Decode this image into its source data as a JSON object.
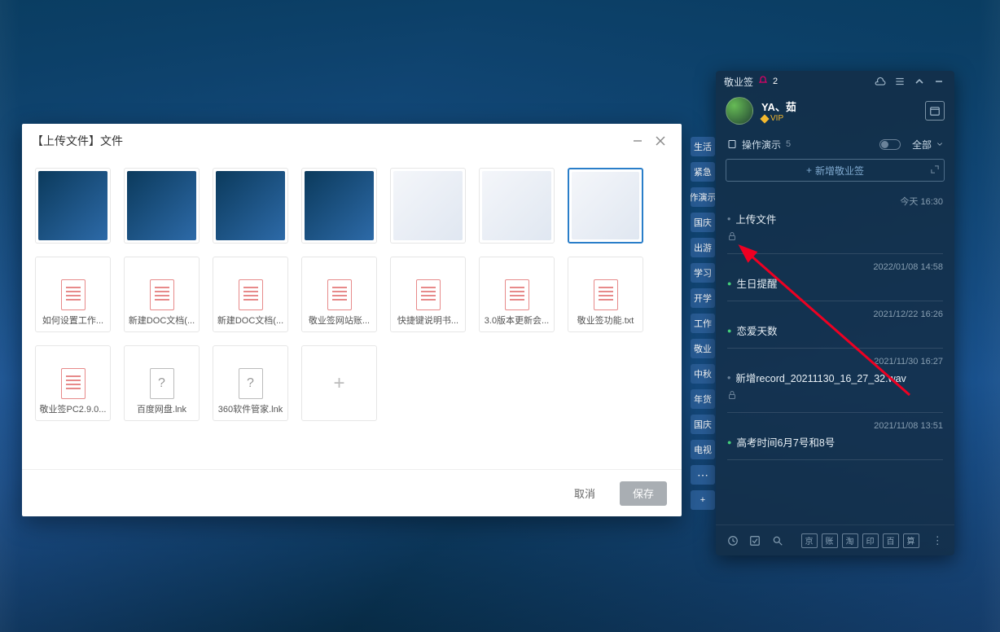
{
  "upload_dialog": {
    "title": "【上传文件】文件",
    "tiles": [
      {
        "type": "img",
        "variant": "dark",
        "name": "screenshot-1"
      },
      {
        "type": "img",
        "variant": "dark",
        "name": "screenshot-2"
      },
      {
        "type": "img",
        "variant": "dark",
        "name": "screenshot-3"
      },
      {
        "type": "img",
        "variant": "dark",
        "name": "screenshot-4"
      },
      {
        "type": "img",
        "variant": "light",
        "name": "screenshot-5"
      },
      {
        "type": "img",
        "variant": "light",
        "name": "screenshot-6"
      },
      {
        "type": "img",
        "variant": "light",
        "name": "screenshot-7",
        "selected": true
      },
      {
        "type": "doc",
        "label": "如何设置工作..."
      },
      {
        "type": "doc",
        "label": "新建DOC文档(..."
      },
      {
        "type": "doc",
        "label": "新建DOC文档(..."
      },
      {
        "type": "doc",
        "label": "敬业签网站账..."
      },
      {
        "type": "doc",
        "label": "快捷键说明书..."
      },
      {
        "type": "doc",
        "label": "3.0版本更新会..."
      },
      {
        "type": "doc",
        "label": "敬业签功能.txt"
      },
      {
        "type": "doc",
        "label": "敬业签PC2.9.0..."
      },
      {
        "type": "unknown",
        "label": "百度网盘.lnk"
      },
      {
        "type": "unknown",
        "label": "360软件管家.lnk"
      },
      {
        "type": "add"
      }
    ],
    "cancel_label": "取消",
    "save_label": "保存"
  },
  "side_tags": [
    "生活",
    "紧急",
    "作演示",
    "国庆",
    "出游",
    "学习",
    "开学",
    "工作",
    "敬业",
    "中秋",
    "年货",
    "国庆",
    "电视"
  ],
  "notes_panel": {
    "app_name": "敬业签",
    "notif_count": "2",
    "username": "YA、茹",
    "vip_label": "VIP",
    "section_title": "操作演示",
    "section_count": "5",
    "filter_label": "全部",
    "add_label": "新增敬业签",
    "items": [
      {
        "time": "今天 16:30",
        "title": "上传文件",
        "lock": true,
        "dashed": true
      },
      {
        "time": "2022/01/08 14:58",
        "title": "生日提醒",
        "green": true
      },
      {
        "time": "2021/12/22 16:26",
        "title": "恋爱天数",
        "green": true
      },
      {
        "time": "2021/11/30 16:27",
        "title": "新增record_20211130_16_27_32.wav",
        "lock": true,
        "dashed": true
      },
      {
        "time": "2021/11/08 13:51",
        "title": "高考时间6月7号和8号",
        "green": true
      }
    ],
    "footer_boxes": [
      "京",
      "账",
      "淘",
      "印",
      "百",
      "算"
    ]
  }
}
